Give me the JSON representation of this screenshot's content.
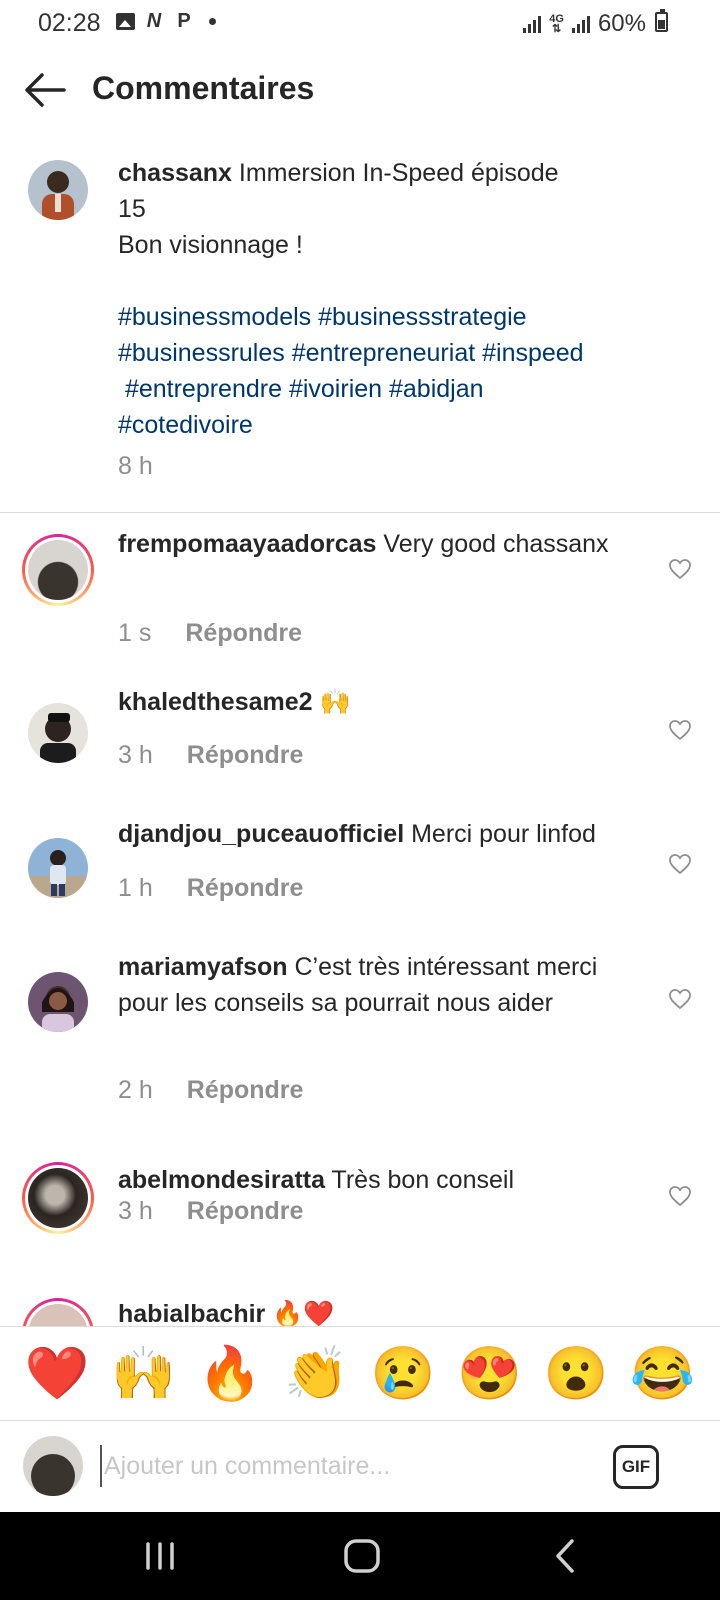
{
  "status_bar": {
    "time": "02:28",
    "battery": "60%"
  },
  "header": {
    "title": "Commentaires"
  },
  "caption": {
    "username": "chassanx",
    "text_line1": " Immersion In-Speed  épisode",
    "text_line2": "15",
    "text_line3": "Bon visionnage !",
    "hashtags_line1": "#businessmodels #businessstrategie",
    "hashtags_line2": "#businessrules #entrepreneuriat #inspeed",
    "hashtags_line3": " #entreprendre #ivoirien #abidjan",
    "hashtags_line4": "#cotedivoire",
    "time": "8 h"
  },
  "reply_label": "Répondre",
  "comments": [
    {
      "username": "frempomaayaadorcas",
      "text": " Very good chassanx",
      "time": "1 s"
    },
    {
      "username": "khaledthesame2",
      "text": " 🙌",
      "time": "3 h"
    },
    {
      "username": "djandjou_puceauofficiel",
      "text": " Merci pour linfod",
      "time": "1 h"
    },
    {
      "username": "mariamyafson",
      "text": " C’est très intéressant merci pour les conseils sa pourrait nous aider",
      "time": "2 h"
    },
    {
      "username": "abelmondesiratta",
      "text": " Très bon conseil",
      "time": "3 h"
    },
    {
      "username": "habialbachir",
      "text": " 🔥❤️"
    }
  ],
  "emoji_bar": [
    "❤️",
    "🙌",
    "🔥",
    "👏",
    "😢",
    "😍",
    "😮",
    "😂"
  ],
  "input": {
    "placeholder": "Ajouter un commentaire...",
    "gif_label": "GIF"
  },
  "colors": {
    "hashtag": "#00376b",
    "secondary_text": "#8e8e8e",
    "divider": "#dbdbdb"
  }
}
